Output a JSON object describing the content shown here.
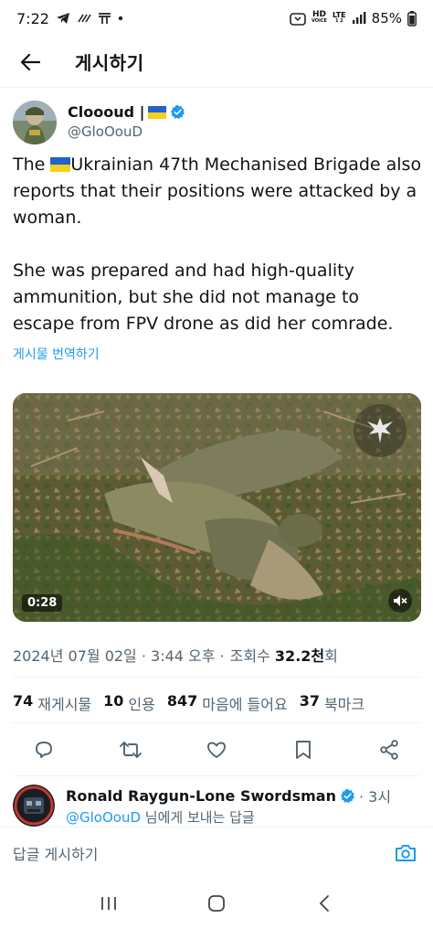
{
  "status_bar": {
    "time": "7:22",
    "battery": "85%",
    "hd_label": "HD",
    "hd_sub": "VOICE",
    "lte_label": "LTE",
    "lte_sub": "1 2"
  },
  "header": {
    "title": "게시하기"
  },
  "tweet": {
    "author_name": "Cloooud |",
    "author_handle": "@GloOouD",
    "body_line1_prefix": "The ",
    "body_line1_rest": "Ukrainian 47th Mechanised Brigade also reports that their positions were attacked by a woman.",
    "body_para2": "She was prepared and had high-quality ammunition, but she did not manage to escape from FPV drone as did her comrade.",
    "translate_label": "게시물 번역하기",
    "video_duration": "0:28",
    "timestamp": "2024년 07월 02일 · 3:44 오후 ·",
    "views_label": "조회수",
    "views_value": "32.2천",
    "views_unit": "회"
  },
  "stats": [
    {
      "value": "74",
      "label": "재게시물"
    },
    {
      "value": "10",
      "label": "인용"
    },
    {
      "value": "847",
      "label": "마음에 들어요"
    },
    {
      "value": "37",
      "label": "북마크"
    }
  ],
  "icons": {
    "reply": "reply-icon",
    "retweet": "retweet-icon",
    "like": "heart-icon",
    "bookmark": "bookmark-icon",
    "share": "share-icon"
  },
  "reply_preview": {
    "name": "Ronald Raygun-Lone Swordsman",
    "time": "· 3시",
    "mention": "@GloOouD",
    "suffix": " 님에게 보내는 답글"
  },
  "composer": {
    "placeholder": "답글 게시하기"
  },
  "colors": {
    "accent": "#1d9bf0",
    "text": "#0f1419",
    "secondary": "#536471"
  }
}
